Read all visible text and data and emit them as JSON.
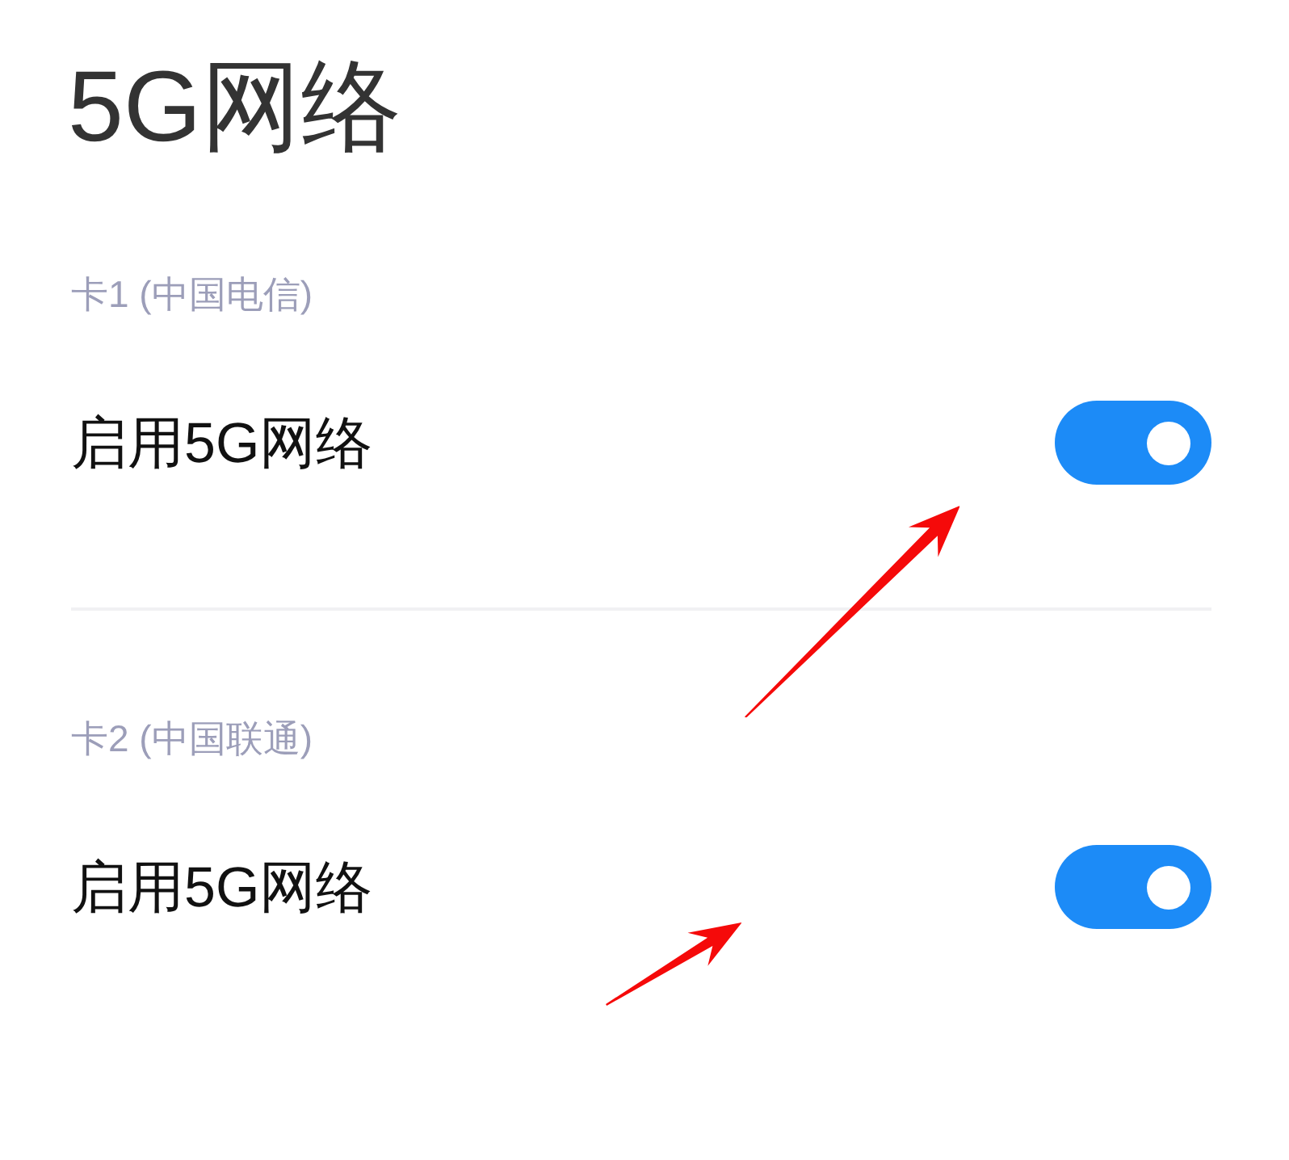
{
  "page": {
    "title": "5G网络"
  },
  "sections": [
    {
      "label": "卡1 (中国电信)",
      "rows": [
        {
          "label": "启用5G网络",
          "on": true
        }
      ]
    },
    {
      "label": "卡2 (中国联通)",
      "rows": [
        {
          "label": "启用5G网络",
          "on": true
        }
      ]
    }
  ]
}
